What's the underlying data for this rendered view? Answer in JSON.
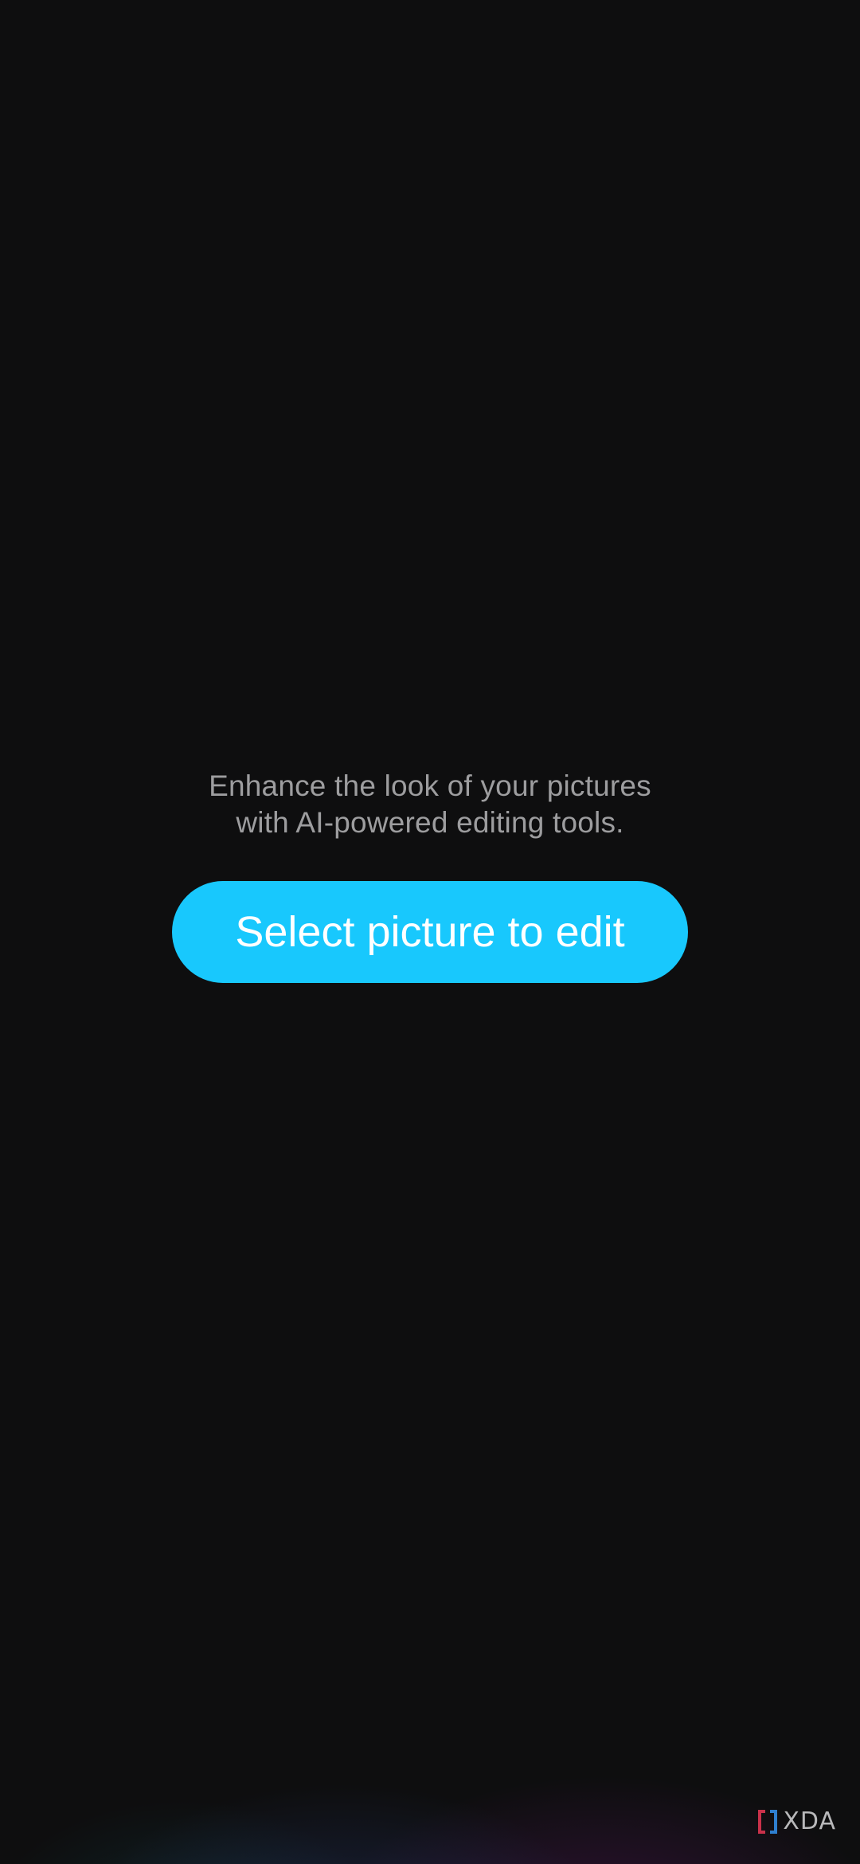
{
  "main": {
    "intro_line_1": "Enhance the look of your pictures",
    "intro_line_2": "with AI-powered editing tools.",
    "select_button_label": "Select picture to edit"
  },
  "watermark": {
    "text": "XDA",
    "icon": "xda-logo-icon"
  },
  "colors": {
    "background": "#0e0e0f",
    "accent": "#18c8fd",
    "intro_text": "#9d9d9f"
  }
}
